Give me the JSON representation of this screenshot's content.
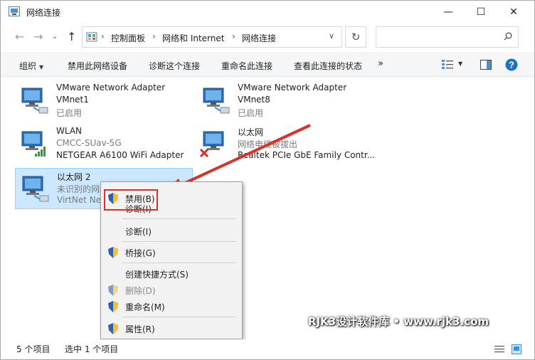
{
  "window": {
    "title": "网络连接"
  },
  "controls": {
    "minimize": "—",
    "maximize": "☐",
    "close": "✕"
  },
  "nav": {
    "breadcrumb": [
      "控制面板",
      "网络和 Internet",
      "网络连接"
    ],
    "search_placeholder": ""
  },
  "toolbar": {
    "organize": "组织",
    "disable_device": "禁用此网络设备",
    "diagnose": "诊断这个连接",
    "rename": "重命名此连接",
    "view_status": "查看此连接的状态",
    "more": "»"
  },
  "connections": [
    {
      "name": "VMware Network Adapter",
      "line2": "VMnet1",
      "line3": "已启用",
      "status_icon": "none"
    },
    {
      "name": "VMware Network Adapter",
      "line2": "VMnet8",
      "line3": "已启用",
      "status_icon": "none"
    },
    {
      "name": "WLAN",
      "line2": "CMCC-SUav-5G",
      "line3": "NETGEAR A6100 WiFi Adapter",
      "status_icon": "wifi-bars-icon"
    },
    {
      "name": "以太网",
      "line2": "网络电缆被拔出",
      "line3": "Realtek PCIe GbE Family Contr...",
      "status_icon": "red-x-icon"
    },
    {
      "name": "以太网 2",
      "line2": "未识别的网络",
      "line3": "VirtNet Ne",
      "status_icon": "none",
      "selected": true
    }
  ],
  "context_menu": {
    "items": [
      {
        "label": "禁用(B)",
        "shield": true,
        "disabled": false
      },
      {
        "label": "诊断(I)",
        "shield": false,
        "disabled": false
      },
      {
        "label": "诊断(I)",
        "shield": false,
        "disabled": false
      },
      {
        "label": "桥接(G)",
        "shield": true,
        "disabled": false
      },
      {
        "label": "创建快捷方式(S)",
        "shield": false,
        "disabled": false
      },
      {
        "label": "删除(D)",
        "shield": true,
        "disabled": true
      },
      {
        "label": "重命名(M)",
        "shield": true,
        "disabled": false
      },
      {
        "label": "属性(R)",
        "shield": true,
        "disabled": false
      }
    ]
  },
  "status_bar": {
    "count": "5 个项目",
    "selected": "选中 1 个项目"
  },
  "watermark": "RJK3设计软件库 • www.rjk3.com",
  "colors": {
    "selection": "#cce8ff",
    "accent_red": "#d6312b",
    "help_blue": "#1a73c9"
  }
}
